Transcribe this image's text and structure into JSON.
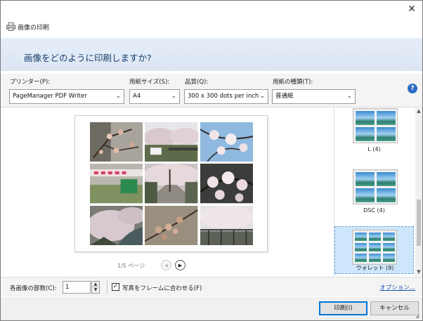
{
  "window": {
    "title": "画像の印刷",
    "close_glyph": "✕"
  },
  "header": {
    "question": "画像をどのように印刷しますか?"
  },
  "options": {
    "printer_label": "プリンター(P):",
    "printer_value": "PageManager PDF Writer",
    "paper_size_label": "用紙サイズ(S):",
    "paper_size_value": "A4",
    "quality_label": "品質(Q):",
    "quality_value": "300 x 300 dots per inch",
    "paper_type_label": "用紙の種類(T):",
    "paper_type_value": "普通紙",
    "help_glyph": "?"
  },
  "preview": {
    "page_indicator": "1/5 ページ",
    "prev_glyph": "◀",
    "next_glyph": "▶",
    "photos": [
      {
        "name": "photo-blossom-buds-1",
        "theme": "buds"
      },
      {
        "name": "photo-riverbank-trees",
        "theme": "riverbank"
      },
      {
        "name": "photo-blossom-sky",
        "theme": "sky"
      },
      {
        "name": "photo-festival-banner",
        "theme": "banner"
      },
      {
        "name": "photo-blossom-path",
        "theme": "path"
      },
      {
        "name": "photo-blossom-branches",
        "theme": "branches"
      },
      {
        "name": "photo-river-blossoms",
        "theme": "river"
      },
      {
        "name": "photo-blossom-buds-2",
        "theme": "buds2"
      },
      {
        "name": "photo-fence-blossoms",
        "theme": "fence"
      }
    ]
  },
  "layouts": {
    "items": [
      {
        "label": "L (4)",
        "selected": false
      },
      {
        "label": "DSC (4)",
        "selected": false
      },
      {
        "label": "ウォレット (9)",
        "selected": true
      }
    ],
    "scroll_up_glyph": "▲",
    "scroll_down_glyph": "▼"
  },
  "bottom": {
    "copies_label": "各画像の部数(C):",
    "copies_value": "1",
    "spin_up_glyph": "▲",
    "spin_down_glyph": "▼",
    "fit_label": "写真をフレームに合わせる(F)",
    "fit_checked": true,
    "check_glyph": "✓",
    "options_link": "オプション..."
  },
  "footer": {
    "print_button": "印刷(I)",
    "cancel_button": "キャンセル"
  },
  "colors": {
    "accent": "#0078d7",
    "header_text": "#1a3d6d",
    "link": "#1a55b0",
    "selected_layout_bg": "#cde6fb"
  }
}
